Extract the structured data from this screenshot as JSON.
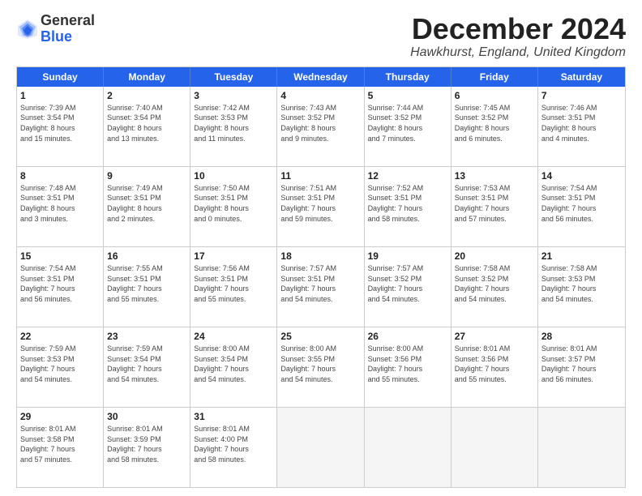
{
  "logo": {
    "general": "General",
    "blue": "Blue"
  },
  "title": "December 2024",
  "location": "Hawkhurst, England, United Kingdom",
  "weekdays": [
    "Sunday",
    "Monday",
    "Tuesday",
    "Wednesday",
    "Thursday",
    "Friday",
    "Saturday"
  ],
  "weeks": [
    [
      {
        "day": "1",
        "info": "Sunrise: 7:39 AM\nSunset: 3:54 PM\nDaylight: 8 hours\nand 15 minutes."
      },
      {
        "day": "2",
        "info": "Sunrise: 7:40 AM\nSunset: 3:54 PM\nDaylight: 8 hours\nand 13 minutes."
      },
      {
        "day": "3",
        "info": "Sunrise: 7:42 AM\nSunset: 3:53 PM\nDaylight: 8 hours\nand 11 minutes."
      },
      {
        "day": "4",
        "info": "Sunrise: 7:43 AM\nSunset: 3:52 PM\nDaylight: 8 hours\nand 9 minutes."
      },
      {
        "day": "5",
        "info": "Sunrise: 7:44 AM\nSunset: 3:52 PM\nDaylight: 8 hours\nand 7 minutes."
      },
      {
        "day": "6",
        "info": "Sunrise: 7:45 AM\nSunset: 3:52 PM\nDaylight: 8 hours\nand 6 minutes."
      },
      {
        "day": "7",
        "info": "Sunrise: 7:46 AM\nSunset: 3:51 PM\nDaylight: 8 hours\nand 4 minutes."
      }
    ],
    [
      {
        "day": "8",
        "info": "Sunrise: 7:48 AM\nSunset: 3:51 PM\nDaylight: 8 hours\nand 3 minutes."
      },
      {
        "day": "9",
        "info": "Sunrise: 7:49 AM\nSunset: 3:51 PM\nDaylight: 8 hours\nand 2 minutes."
      },
      {
        "day": "10",
        "info": "Sunrise: 7:50 AM\nSunset: 3:51 PM\nDaylight: 8 hours\nand 0 minutes."
      },
      {
        "day": "11",
        "info": "Sunrise: 7:51 AM\nSunset: 3:51 PM\nDaylight: 7 hours\nand 59 minutes."
      },
      {
        "day": "12",
        "info": "Sunrise: 7:52 AM\nSunset: 3:51 PM\nDaylight: 7 hours\nand 58 minutes."
      },
      {
        "day": "13",
        "info": "Sunrise: 7:53 AM\nSunset: 3:51 PM\nDaylight: 7 hours\nand 57 minutes."
      },
      {
        "day": "14",
        "info": "Sunrise: 7:54 AM\nSunset: 3:51 PM\nDaylight: 7 hours\nand 56 minutes."
      }
    ],
    [
      {
        "day": "15",
        "info": "Sunrise: 7:54 AM\nSunset: 3:51 PM\nDaylight: 7 hours\nand 56 minutes."
      },
      {
        "day": "16",
        "info": "Sunrise: 7:55 AM\nSunset: 3:51 PM\nDaylight: 7 hours\nand 55 minutes."
      },
      {
        "day": "17",
        "info": "Sunrise: 7:56 AM\nSunset: 3:51 PM\nDaylight: 7 hours\nand 55 minutes."
      },
      {
        "day": "18",
        "info": "Sunrise: 7:57 AM\nSunset: 3:51 PM\nDaylight: 7 hours\nand 54 minutes."
      },
      {
        "day": "19",
        "info": "Sunrise: 7:57 AM\nSunset: 3:52 PM\nDaylight: 7 hours\nand 54 minutes."
      },
      {
        "day": "20",
        "info": "Sunrise: 7:58 AM\nSunset: 3:52 PM\nDaylight: 7 hours\nand 54 minutes."
      },
      {
        "day": "21",
        "info": "Sunrise: 7:58 AM\nSunset: 3:53 PM\nDaylight: 7 hours\nand 54 minutes."
      }
    ],
    [
      {
        "day": "22",
        "info": "Sunrise: 7:59 AM\nSunset: 3:53 PM\nDaylight: 7 hours\nand 54 minutes."
      },
      {
        "day": "23",
        "info": "Sunrise: 7:59 AM\nSunset: 3:54 PM\nDaylight: 7 hours\nand 54 minutes."
      },
      {
        "day": "24",
        "info": "Sunrise: 8:00 AM\nSunset: 3:54 PM\nDaylight: 7 hours\nand 54 minutes."
      },
      {
        "day": "25",
        "info": "Sunrise: 8:00 AM\nSunset: 3:55 PM\nDaylight: 7 hours\nand 54 minutes."
      },
      {
        "day": "26",
        "info": "Sunrise: 8:00 AM\nSunset: 3:56 PM\nDaylight: 7 hours\nand 55 minutes."
      },
      {
        "day": "27",
        "info": "Sunrise: 8:01 AM\nSunset: 3:56 PM\nDaylight: 7 hours\nand 55 minutes."
      },
      {
        "day": "28",
        "info": "Sunrise: 8:01 AM\nSunset: 3:57 PM\nDaylight: 7 hours\nand 56 minutes."
      }
    ],
    [
      {
        "day": "29",
        "info": "Sunrise: 8:01 AM\nSunset: 3:58 PM\nDaylight: 7 hours\nand 57 minutes."
      },
      {
        "day": "30",
        "info": "Sunrise: 8:01 AM\nSunset: 3:59 PM\nDaylight: 7 hours\nand 58 minutes."
      },
      {
        "day": "31",
        "info": "Sunrise: 8:01 AM\nSunset: 4:00 PM\nDaylight: 7 hours\nand 58 minutes."
      },
      {
        "day": "",
        "info": ""
      },
      {
        "day": "",
        "info": ""
      },
      {
        "day": "",
        "info": ""
      },
      {
        "day": "",
        "info": ""
      }
    ]
  ]
}
